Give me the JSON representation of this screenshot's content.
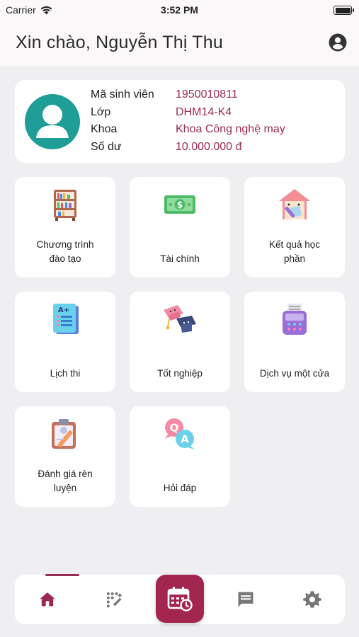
{
  "status_bar": {
    "carrier": "Carrier",
    "time": "3:52 PM"
  },
  "header": {
    "greeting": "Xin chào, Nguyễn Thị Thu"
  },
  "profile": {
    "student_id_label": "Mã sinh viên",
    "student_id": "1950010811",
    "class_label": "Lớp",
    "class": "DHM14-K4",
    "faculty_label": "Khoa",
    "faculty": "Khoa Công nghệ may",
    "balance_label": "Số dư",
    "balance": "10.000.000 đ"
  },
  "tiles": [
    {
      "label_line1": "Chương trình",
      "label_line2": "đào tạo",
      "icon": "bookshelf-icon"
    },
    {
      "label_line1": "Tài chính",
      "icon": "money-icon"
    },
    {
      "label_line1": "Kết quả học",
      "label_line2": "phần",
      "icon": "house-pencil-icon"
    },
    {
      "label_line1": "Lịch thi",
      "icon": "exam-paper-icon"
    },
    {
      "label_line1": "Tốt nghiệp",
      "icon": "graduation-caps-icon"
    },
    {
      "label_line1": "Dịch vụ một cửa",
      "icon": "payment-terminal-icon"
    },
    {
      "label_line1": "Đánh giá rèn",
      "label_line2": "luyện",
      "icon": "clipboard-pencil-icon"
    },
    {
      "label_line1": "Hỏi đáp",
      "icon": "qa-bubbles-icon"
    }
  ],
  "bottom_nav": {
    "items": [
      "home-icon",
      "magic-icon",
      "schedule-icon",
      "chat-icon",
      "settings-icon"
    ],
    "active": "home-icon"
  },
  "colors": {
    "accent": "#9a2a55",
    "center_button": "#a3264f",
    "avatar_teal": "#1e9e97"
  }
}
